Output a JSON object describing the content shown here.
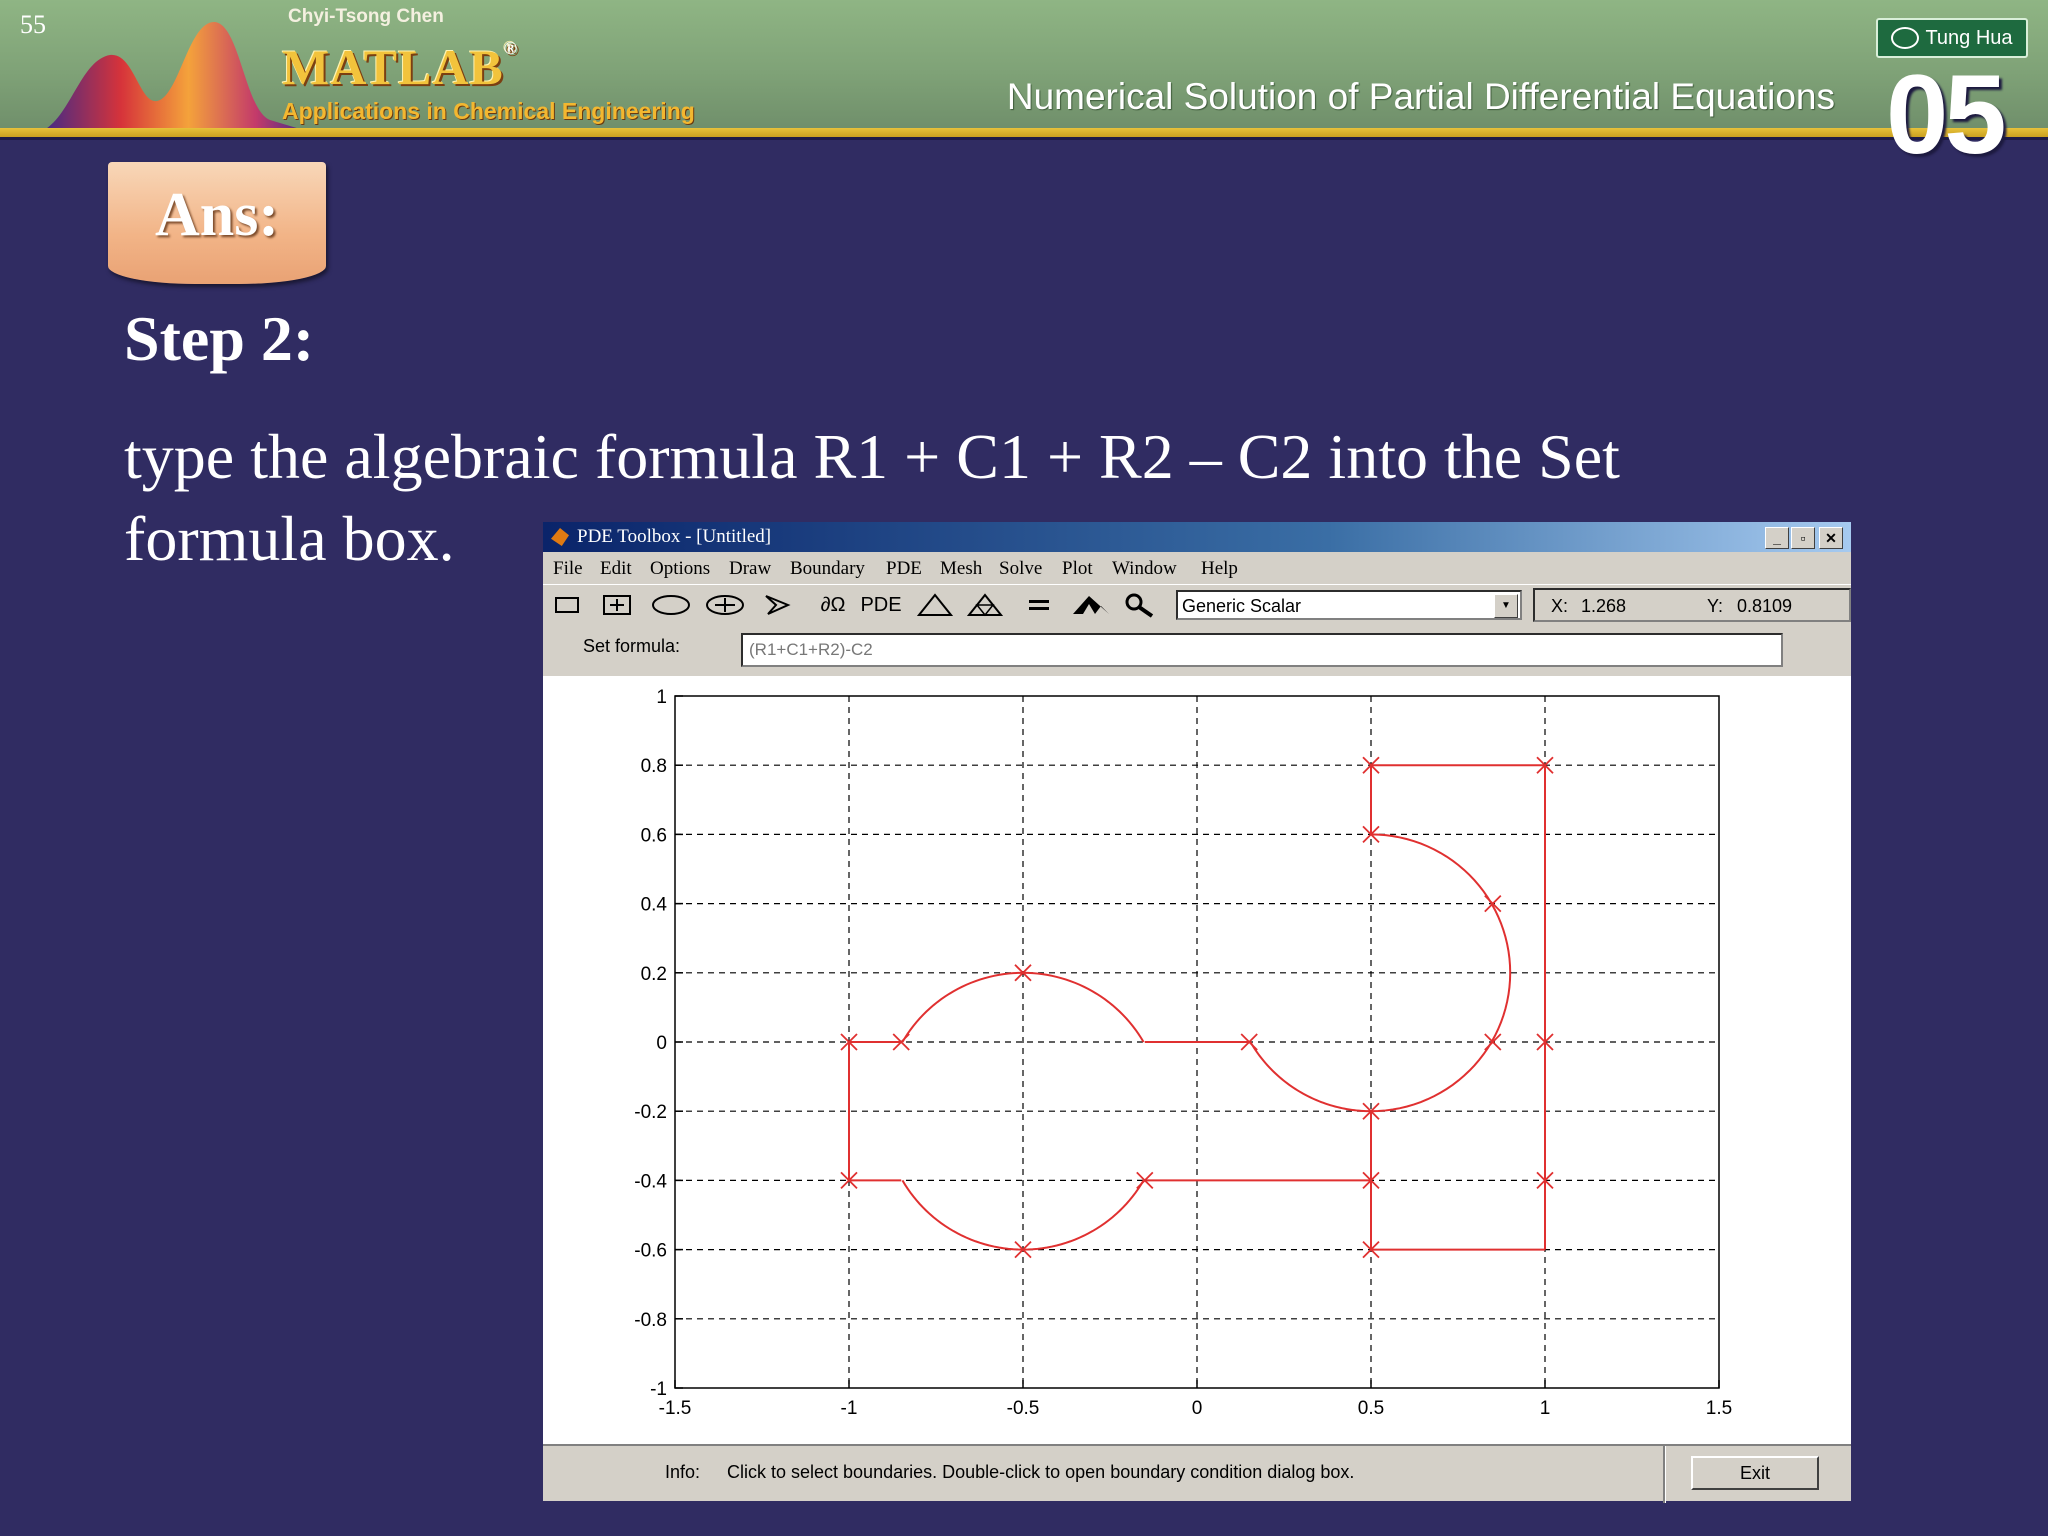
{
  "slide": {
    "page_number": "55",
    "author": "Chyi-Tsong Chen",
    "logo_text": "MATLAB",
    "logo_reg": "®",
    "app_subtitle": "Applications in Chemical Engineering",
    "page_title": "Numerical Solution of Partial Differential Equations",
    "publisher": "Tung Hua",
    "chapter": "05",
    "badge": "Ans:",
    "step": "Step 2:",
    "body_line1": "type the algebraic formula R1 + C1 + R2 –  C2 into the Set",
    "body_line2": "formula box."
  },
  "window": {
    "title": "PDE Toolbox - [Untitled]",
    "controls": [
      "_",
      "▫",
      "✕"
    ],
    "menu": [
      "File",
      "Edit",
      "Options",
      "Draw",
      "Boundary",
      "PDE",
      "Mesh",
      "Solve",
      "Plot",
      "Window",
      "Help"
    ],
    "toolbar": {
      "tools": [
        "rectangle-icon",
        "centered-rectangle-icon",
        "ellipse-icon",
        "centered-ellipse-icon",
        "polygon-icon",
        "boundary-mode-icon",
        "pde-spec-icon",
        "mesh-icon",
        "refine-mesh-icon",
        "equals-icon",
        "solve-icon",
        "zoom-icon"
      ],
      "boundary_label": "∂Ω",
      "pde_label": "PDE",
      "application_mode": "Generic Scalar",
      "x_label": "X:",
      "x_value": "1.268",
      "y_label": "Y:",
      "y_value": "0.8109"
    },
    "formula": {
      "label": "Set formula:",
      "value": "(R1+C1+R2)-C2"
    },
    "status": {
      "info_label": "Info:",
      "info_text": "Click to select boundaries. Double-click to open boundary condition dialog box.",
      "exit_label": "Exit"
    }
  },
  "chart_data": {
    "type": "line",
    "title": "",
    "xlim": [
      -1.5,
      1.5
    ],
    "ylim": [
      -1,
      1
    ],
    "x_ticks": [
      -1.5,
      -1,
      -0.5,
      0,
      0.5,
      1,
      1.5
    ],
    "y_ticks": [
      1,
      0.8,
      0.6,
      0.4,
      0.2,
      0,
      -0.2,
      -0.4,
      -0.6,
      -0.8,
      -1
    ],
    "x_tick_labels": [
      "-1.5",
      "-1",
      "-0.5",
      "0",
      "0.5",
      "1",
      "1.5"
    ],
    "y_tick_labels": [
      "1",
      "0.8",
      "0.6",
      "0.4",
      "0.2",
      "0",
      "-0.2",
      "-0.4",
      "-0.6",
      "-0.8",
      "-1"
    ],
    "grid": true,
    "line_color": "#e03030",
    "segments": [
      {
        "kind": "line",
        "from": [
          -1,
          0
        ],
        "to": [
          -1,
          -0.4
        ]
      },
      {
        "kind": "line",
        "from": [
          -1,
          0
        ],
        "to": [
          -0.85,
          0
        ]
      },
      {
        "kind": "line",
        "from": [
          -1,
          -0.4
        ],
        "to": [
          -0.85,
          -0.4
        ]
      },
      {
        "kind": "arc",
        "center": [
          -0.5,
          -0.2
        ],
        "radius": 0.4,
        "from_deg": 150,
        "to_deg": 30
      },
      {
        "kind": "arc",
        "center": [
          -0.5,
          -0.2
        ],
        "radius": 0.4,
        "from_deg": 210,
        "to_deg": 330
      },
      {
        "kind": "line",
        "from": [
          -0.15,
          0
        ],
        "to": [
          0.15,
          0
        ]
      },
      {
        "kind": "line",
        "from": [
          -0.15,
          -0.4
        ],
        "to": [
          0.5,
          -0.4
        ]
      },
      {
        "kind": "arc",
        "center": [
          0.5,
          0.2
        ],
        "radius": 0.4,
        "from_deg": 210,
        "to_deg": 270
      },
      {
        "kind": "arc",
        "center": [
          0.5,
          0.2
        ],
        "radius": 0.4,
        "from_deg": 270,
        "to_deg": 450
      },
      {
        "kind": "line",
        "from": [
          0.5,
          0.8
        ],
        "to": [
          1,
          0.8
        ]
      },
      {
        "kind": "line",
        "from": [
          0.5,
          0.8
        ],
        "to": [
          0.5,
          0.6
        ]
      },
      {
        "kind": "line",
        "from": [
          1,
          0.8
        ],
        "to": [
          1,
          -0.6
        ]
      },
      {
        "kind": "line",
        "from": [
          1,
          -0.6
        ],
        "to": [
          0.5,
          -0.6
        ]
      },
      {
        "kind": "line",
        "from": [
          0.5,
          -0.6
        ],
        "to": [
          0.5,
          -0.2
        ]
      }
    ],
    "markers": [
      [
        -1,
        0
      ],
      [
        -1,
        -0.4
      ],
      [
        -0.85,
        0
      ],
      [
        -0.5,
        0.2
      ],
      [
        -0.5,
        -0.6
      ],
      [
        -0.15,
        -0.4
      ],
      [
        0.15,
        0
      ],
      [
        0.5,
        -0.2
      ],
      [
        0.5,
        -0.4
      ],
      [
        0.5,
        -0.6
      ],
      [
        0.5,
        0.6
      ],
      [
        0.5,
        0.8
      ],
      [
        1,
        0.8
      ],
      [
        0.85,
        0.4
      ],
      [
        0.85,
        0
      ],
      [
        1,
        0
      ],
      [
        1,
        -0.4
      ]
    ]
  }
}
